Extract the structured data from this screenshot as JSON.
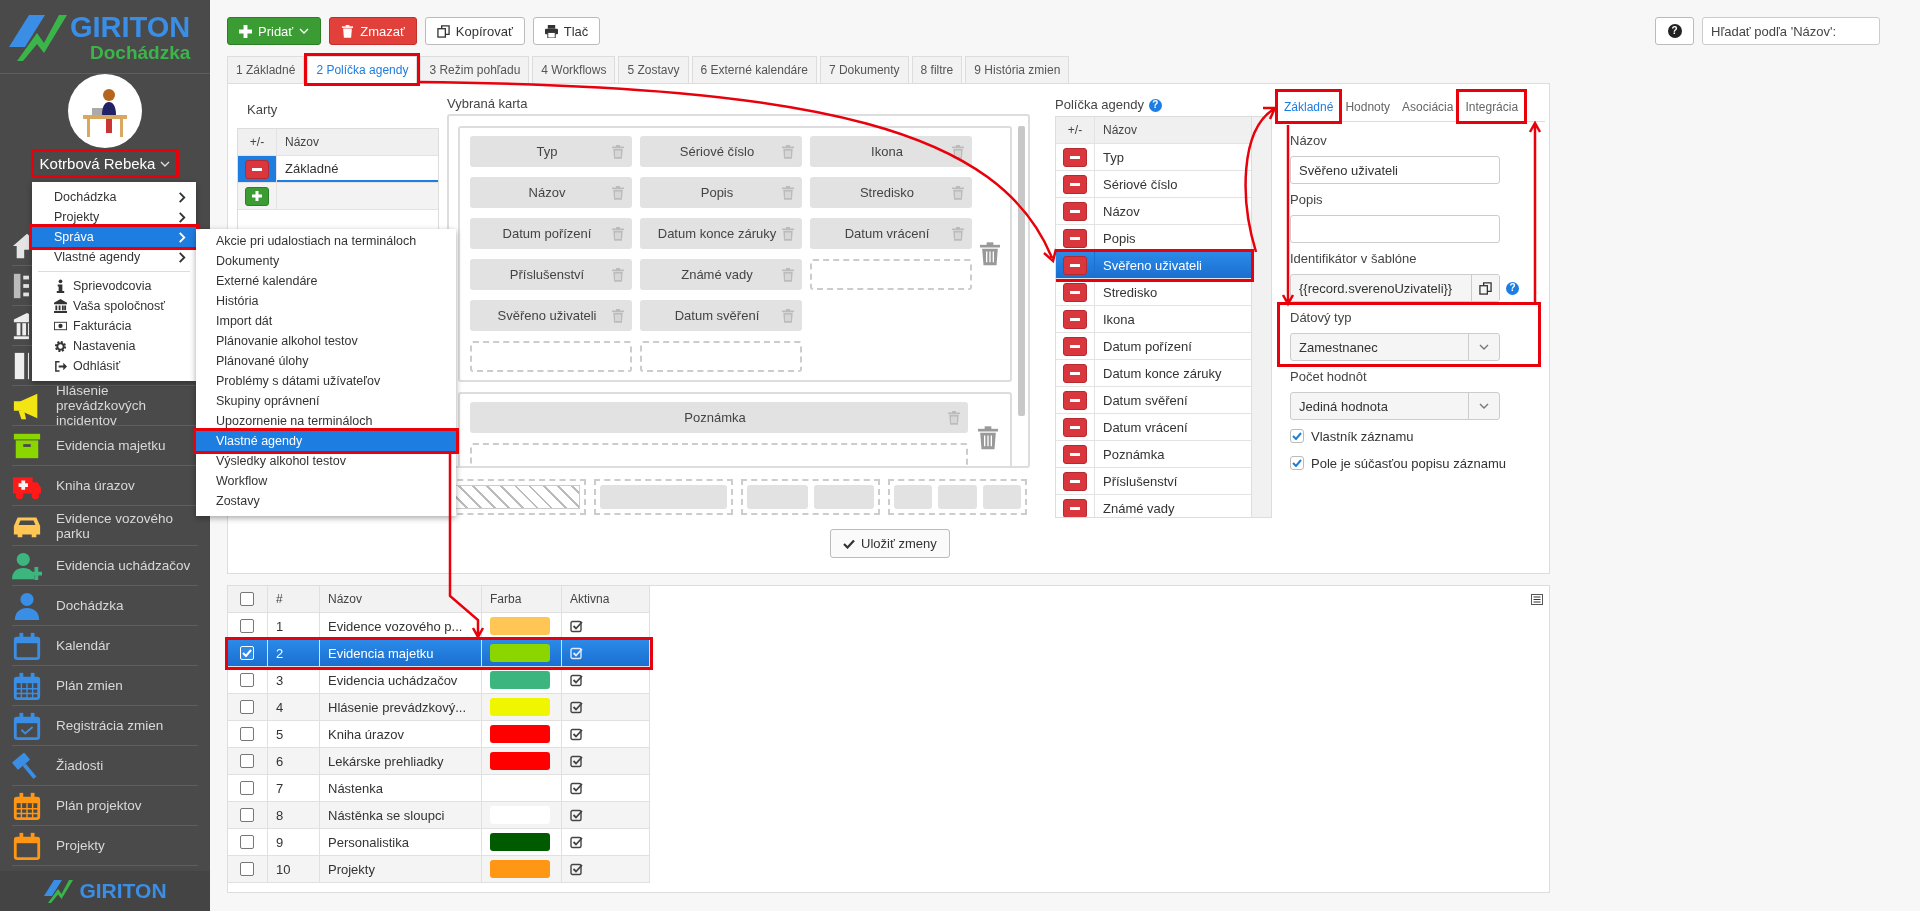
{
  "sidebar": {
    "logo_title": "GIRITON",
    "logo_subtitle": "Dochádzka",
    "user_name": "Kotrbová Rebeka",
    "user_highlighted": true,
    "nav": [
      {
        "kind": "home"
      },
      {
        "kind": "numbered-list"
      },
      {
        "kind": "bank"
      },
      {
        "kind": "columns"
      },
      {
        "kind": "megaphone",
        "label": "Hlásenie prevádzkových incidentov"
      },
      {
        "kind": "archive",
        "label": "Evidencia majetku"
      },
      {
        "kind": "ambulance",
        "label": "Kniha úrazov"
      },
      {
        "kind": "car",
        "label": "Evidence vozového parku"
      },
      {
        "kind": "user-plus",
        "label": "Evidencia uchádzačov"
      },
      {
        "kind": "user",
        "label": "Dochádzka"
      },
      {
        "kind": "calendar",
        "label": "Kalendár"
      },
      {
        "kind": "calendar-grid",
        "label": "Plán zmien"
      },
      {
        "kind": "calendar-check",
        "label": "Registrácia zmien"
      },
      {
        "kind": "gavel",
        "label": "Žiadosti"
      },
      {
        "kind": "calendar-grid-orange",
        "label": "Plán projektov"
      },
      {
        "kind": "calendar-orange",
        "label": "Projekty"
      }
    ],
    "footer_logo": "GIRITON"
  },
  "user_menu": {
    "submenus": [
      {
        "label": "Dochádzka",
        "selected": false,
        "highlighted": false
      },
      {
        "label": "Projekty",
        "selected": false,
        "highlighted": false
      },
      {
        "label": "Správa",
        "selected": true,
        "highlighted": true
      },
      {
        "label": "Vlastné agendy",
        "selected": false,
        "highlighted": false
      }
    ],
    "actions": [
      {
        "kind": "info",
        "label": "Sprievodcovia"
      },
      {
        "kind": "bank",
        "label": "Vaša spoločnosť"
      },
      {
        "kind": "billing",
        "label": "Fakturácia"
      },
      {
        "kind": "gear",
        "label": "Nastavenia"
      },
      {
        "kind": "logout",
        "label": "Odhlásiť"
      }
    ]
  },
  "submenu": {
    "items": [
      {
        "label": "Akcie pri udalostiach na termináloch",
        "selected": false,
        "highlighted": false
      },
      {
        "label": "Dokumenty",
        "selected": false,
        "highlighted": false
      },
      {
        "label": "Externé kalendáre",
        "selected": false,
        "highlighted": false
      },
      {
        "label": "História",
        "selected": false,
        "highlighted": false
      },
      {
        "label": "Import dát",
        "selected": false,
        "highlighted": false
      },
      {
        "label": "Plánovanie alkohol testov",
        "selected": false,
        "highlighted": false
      },
      {
        "label": "Plánované úlohy",
        "selected": false,
        "highlighted": false
      },
      {
        "label": "Problémy s dátami užívateľov",
        "selected": false,
        "highlighted": false
      },
      {
        "label": "Skupiny oprávnení",
        "selected": false,
        "highlighted": false
      },
      {
        "label": "Upozornenie na termináloch",
        "selected": false,
        "highlighted": false
      },
      {
        "label": "Vlastné agendy",
        "selected": true,
        "highlighted": true
      },
      {
        "label": "Výsledky alkohol testov",
        "selected": false,
        "highlighted": false
      },
      {
        "label": "Workflow",
        "selected": false,
        "highlighted": false
      },
      {
        "label": "Zostavy",
        "selected": false,
        "highlighted": false
      }
    ]
  },
  "toolbar": {
    "buttons": [
      {
        "kind": "add",
        "label": "Pridať"
      },
      {
        "kind": "delete",
        "label": "Zmazať"
      },
      {
        "kind": "copy",
        "label": "Kopírovať"
      },
      {
        "kind": "print",
        "label": "Tlač"
      }
    ],
    "help_icon": "?",
    "search": {
      "placeholder": "Hľadať podľa 'Názov':"
    }
  },
  "tabs": [
    {
      "label": "1 Základné",
      "selected": false,
      "highlighted": false
    },
    {
      "label": "2 Políčka agendy",
      "selected": true,
      "highlighted": true
    },
    {
      "label": "3 Režim pohľadu",
      "selected": false,
      "highlighted": false
    },
    {
      "label": "4 Workflows",
      "selected": false,
      "highlighted": false
    },
    {
      "label": "5 Zostavy",
      "selected": false,
      "highlighted": false
    },
    {
      "label": "6 Externé kalendáre",
      "selected": false,
      "highlighted": false
    },
    {
      "label": "7 Dokumenty",
      "selected": false,
      "highlighted": false
    },
    {
      "label": "8 filtre",
      "selected": false,
      "highlighted": false
    },
    {
      "label": "9 História zmien",
      "selected": false,
      "highlighted": false
    }
  ],
  "cards": {
    "title": "Karty",
    "columns": [
      "+/-",
      "Názov"
    ],
    "rows": [
      {
        "name": "Základné",
        "selected": true
      }
    ]
  },
  "selected_card": {
    "title": "Vybraná karta",
    "groups": [
      {
        "columns": [
          [
            "Typ",
            "Názov",
            "Datum pořízení",
            "Příslušenství",
            "Svěřeno uživateli"
          ],
          [
            "Sériové číslo",
            "Popis",
            "Datum konce záruky",
            "Známé vady",
            "Datum svěření"
          ],
          [
            "Ikona",
            "Stredisko",
            "Datum vrácení"
          ]
        ]
      },
      {
        "columns": [
          [
            "Poznámka"
          ]
        ]
      }
    ],
    "save_label": "Uložiť zmeny"
  },
  "fields": {
    "title": "Políčka agendy",
    "help_icon": "?",
    "columns": [
      "+/-",
      "Názov"
    ],
    "rows": [
      {
        "name": "Typ",
        "selected": false,
        "highlighted": false
      },
      {
        "name": "Sériové číslo",
        "selected": false,
        "highlighted": false
      },
      {
        "name": "Názov",
        "selected": false,
        "highlighted": false
      },
      {
        "name": "Popis",
        "selected": false,
        "highlighted": false
      },
      {
        "name": "Svěřeno uživateli",
        "selected": true,
        "highlighted": true
      },
      {
        "name": "Stredisko",
        "selected": false,
        "highlighted": false
      },
      {
        "name": "Ikona",
        "selected": false,
        "highlighted": false
      },
      {
        "name": "Datum pořízení",
        "selected": false,
        "highlighted": false
      },
      {
        "name": "Datum konce záruky",
        "selected": false,
        "highlighted": false
      },
      {
        "name": "Datum svěření",
        "selected": false,
        "highlighted": false
      },
      {
        "name": "Datum vrácení",
        "selected": false,
        "highlighted": false
      },
      {
        "name": "Poznámka",
        "selected": false,
        "highlighted": false
      },
      {
        "name": "Příslušenství",
        "selected": false,
        "highlighted": false
      },
      {
        "name": "Známé vady",
        "selected": false,
        "highlighted": false
      }
    ]
  },
  "field_form": {
    "tabs": [
      {
        "label": "Základné",
        "selected": true,
        "highlighted": true
      },
      {
        "label": "Hodnoty",
        "selected": false,
        "highlighted": false
      },
      {
        "label": "Asociácia",
        "selected": false,
        "highlighted": false
      },
      {
        "label": "Integrácia",
        "selected": false,
        "highlighted": true
      }
    ],
    "fields": [
      {
        "kind": "text",
        "label": "Názov",
        "value": "Svěřeno uživateli",
        "highlighted": false
      },
      {
        "kind": "text",
        "label": "Popis",
        "highlighted": false
      },
      {
        "kind": "copy",
        "label": "Identifikátor v šablóne",
        "value": "{{record.sverenoUzivateli}}",
        "help_icon": "?",
        "highlighted": false
      },
      {
        "kind": "select",
        "label": "Dátový typ",
        "value": "Zamestnanec",
        "highlighted": true
      },
      {
        "kind": "select",
        "label": "Počet hodnôt",
        "value": "Jediná hodnota",
        "highlighted": false
      },
      {
        "kind": "checkbox",
        "label": "Vlastník záznamu",
        "checked": true,
        "highlighted": false
      },
      {
        "kind": "checkbox",
        "label": "Pole je súčasťou popisu záznamu",
        "checked": true,
        "highlighted": false
      }
    ]
  },
  "agendas": {
    "all_checked": false,
    "columns": [
      "#",
      "Názov",
      "Farba",
      "Aktivna"
    ],
    "rows": [
      {
        "number": "1",
        "name": "Evidence vozového p...",
        "color": "#ffc655",
        "active": true,
        "checked": false,
        "selected": false,
        "highlighted": false
      },
      {
        "number": "2",
        "name": "Evidencia majetku",
        "color": "#8cd600",
        "active": true,
        "checked": true,
        "selected": true,
        "highlighted": true
      },
      {
        "number": "3",
        "name": "Evidencia uchádzačov",
        "color": "#3cb67e",
        "active": true,
        "checked": false,
        "selected": false,
        "highlighted": false
      },
      {
        "number": "4",
        "name": "Hlásenie prevádzkový...",
        "color": "#f0f500",
        "active": true,
        "checked": false,
        "selected": false,
        "highlighted": false
      },
      {
        "number": "5",
        "name": "Kniha úrazov",
        "color": "#ff0000",
        "active": true,
        "checked": false,
        "selected": false,
        "highlighted": false
      },
      {
        "number": "6",
        "name": "Lekárske prehliadky",
        "color": "#ff0000",
        "active": true,
        "checked": false,
        "selected": false,
        "highlighted": false
      },
      {
        "number": "7",
        "name": "Nástenka",
        "active": true,
        "checked": false,
        "selected": false,
        "highlighted": false
      },
      {
        "number": "8",
        "name": "Nástěnka se sloupci",
        "color": "#ffffff",
        "active": true,
        "checked": false,
        "selected": false,
        "highlighted": false
      },
      {
        "number": "9",
        "name": "Personalistika",
        "color": "#005a00",
        "active": true,
        "checked": false,
        "selected": false,
        "highlighted": false
      },
      {
        "number": "10",
        "name": "Projekty",
        "color": "#ff9614",
        "active": true,
        "checked": false,
        "selected": false,
        "highlighted": false
      }
    ]
  }
}
